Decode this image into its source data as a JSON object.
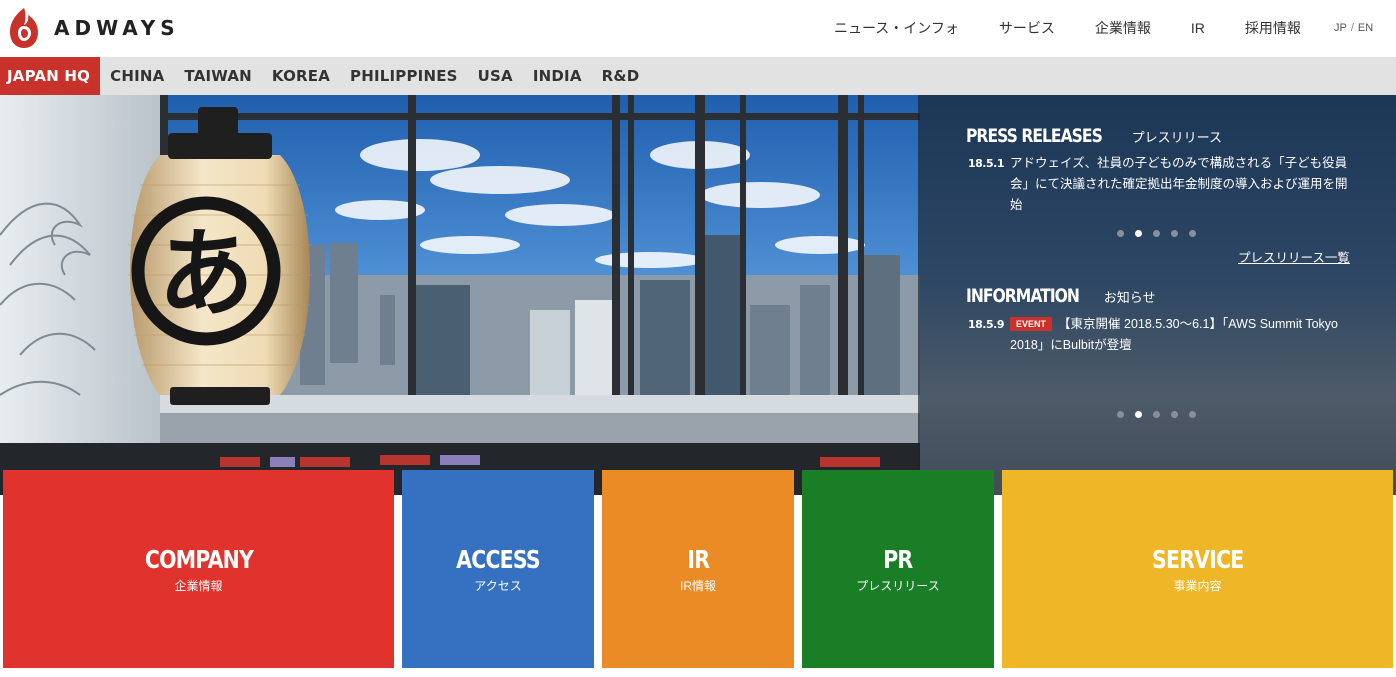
{
  "brand": {
    "name": "ADWAYS",
    "red": "#c8322b"
  },
  "global_nav": [
    {
      "label": "ニュース・インフォ"
    },
    {
      "label": "サービス"
    },
    {
      "label": "企業情報"
    },
    {
      "label": "IR"
    },
    {
      "label": "採用情報"
    }
  ],
  "lang": {
    "jp": "JP",
    "sep": "/",
    "en": "EN"
  },
  "regions": [
    {
      "label": "JAPAN HQ",
      "active": true
    },
    {
      "label": "CHINA"
    },
    {
      "label": "TAIWAN"
    },
    {
      "label": "KOREA"
    },
    {
      "label": "PHILIPPINES"
    },
    {
      "label": "USA"
    },
    {
      "label": "INDIA"
    },
    {
      "label": "R&D"
    }
  ],
  "hero": {
    "lantern_char": "あ",
    "press": {
      "title_en": "PRESS RELEASES",
      "title_ja": "プレスリリース",
      "date": "18.5.1",
      "text": "アドウェイズ、社員の子どものみで構成される「子ども役員会」にて決議された確定拠出年金制度の導入および運用を開始",
      "dots_total": 5,
      "dots_active": 2,
      "list_link": "プレスリリース一覧"
    },
    "info": {
      "title_en": "INFORMATION",
      "title_ja": "お知らせ",
      "date": "18.5.9",
      "badge": "EVENT",
      "text": "【東京開催 2018.5.30〜6.1】「AWS Summit Tokyo 2018」にBulbitが登壇",
      "dots_total": 5,
      "dots_active": 2
    }
  },
  "tiles": [
    {
      "en": "COMPANY",
      "ja": "企業情報",
      "color": "#e0332d"
    },
    {
      "en": "ACCESS",
      "ja": "アクセス",
      "color": "#3571c0"
    },
    {
      "en": "IR",
      "ja": "IR情報",
      "color": "#ea8b25"
    },
    {
      "en": "PR",
      "ja": "プレスリリース",
      "color": "#1a7e26"
    },
    {
      "en": "SERVICE",
      "ja": "事業内容",
      "color": "#efb727"
    }
  ]
}
